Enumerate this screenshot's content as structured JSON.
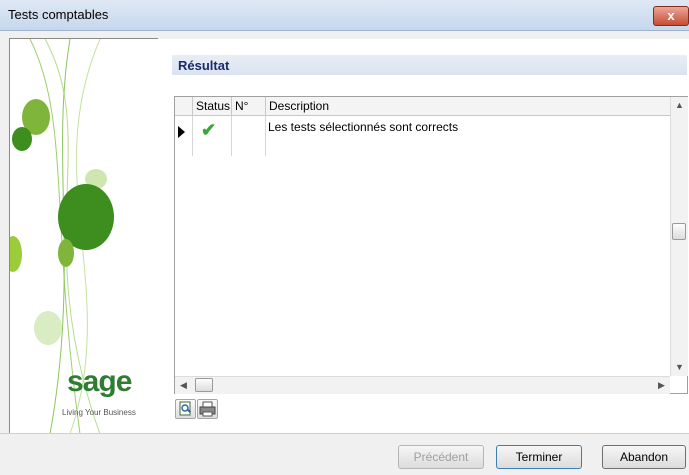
{
  "window": {
    "title": "Tests comptables",
    "close_label": "x"
  },
  "branding": {
    "logo_text": "sage",
    "tagline": "Living Your Business",
    "leaf_colors": [
      "#7fb53a",
      "#3e8e1f",
      "#b7d88c",
      "#d9ecc4"
    ]
  },
  "section": {
    "title": "Résultat"
  },
  "grid": {
    "columns": [
      "Status",
      "N°",
      "Description"
    ],
    "rows": [
      {
        "status_icon": "check-icon",
        "status_glyph": "✔",
        "number": "",
        "description": "Les tests sélectionnés sont corrects"
      }
    ]
  },
  "toolbar": {
    "print_preview_icon": "print-preview-icon",
    "print_icon": "printer-icon"
  },
  "buttons": {
    "previous": "Précédent",
    "finish": "Terminer",
    "abort": "Abandon"
  },
  "colors": {
    "accent": "#1a2a6c",
    "check": "#3aa63a",
    "brand_green": "#2e7d32"
  }
}
